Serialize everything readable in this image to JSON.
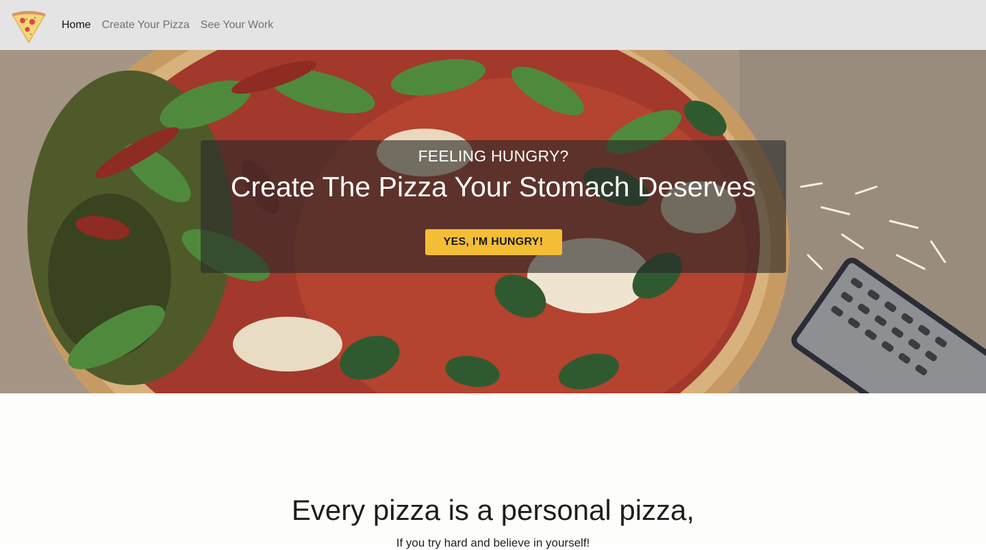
{
  "nav": {
    "logo_icon": "pizza-slice-icon",
    "links": [
      {
        "label": "Home",
        "active": true
      },
      {
        "label": "Create Your Pizza",
        "active": false
      },
      {
        "label": "See Your Work",
        "active": false
      }
    ]
  },
  "hero": {
    "background": "pizza-photo",
    "eyebrow": "FEELING HUNGRY?",
    "title": "Create The Pizza Your Stomach Deserves",
    "cta_label": "YES, I'M HUNGRY!"
  },
  "intro": {
    "heading": "Every pizza is a personal pizza,",
    "subtext": "If you try hard and believe in yourself!"
  },
  "colors": {
    "navbar_bg": "#e4e4e4",
    "cta_bg": "#f3be35",
    "overlay": "rgba(40,40,40,0.62)"
  }
}
